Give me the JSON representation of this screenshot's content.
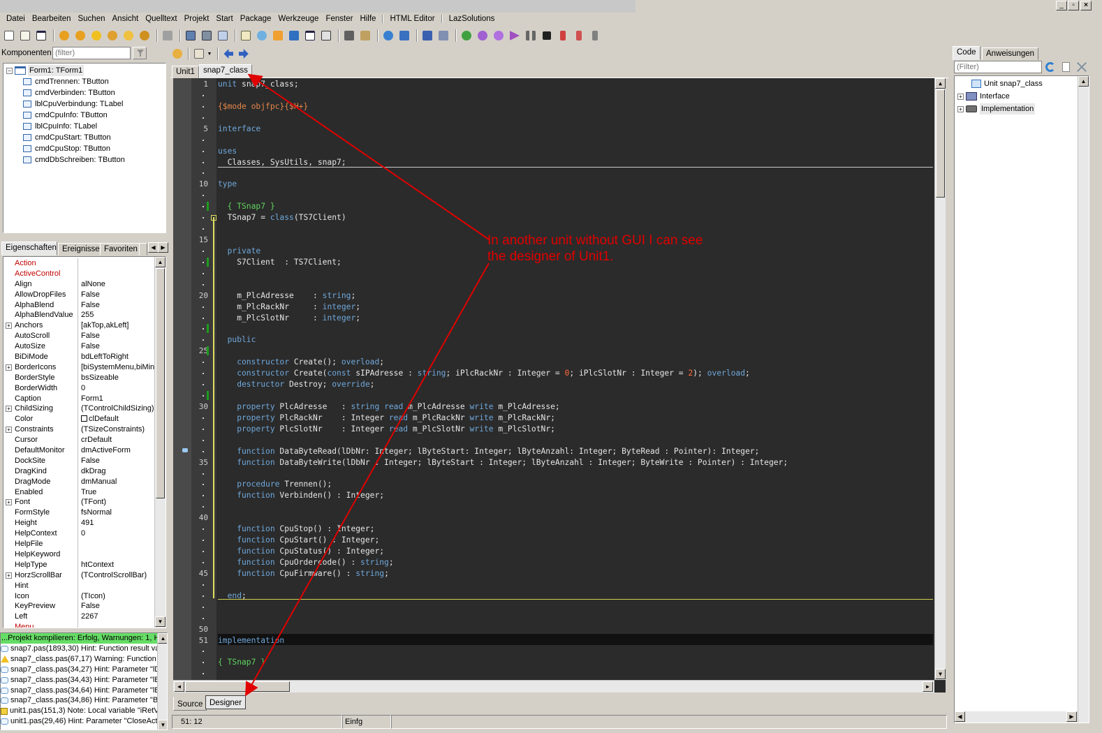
{
  "menu": [
    "Datei",
    "Bearbeiten",
    "Suchen",
    "Ansicht",
    "Quelltext",
    "Projekt",
    "Start",
    "Package",
    "Werkzeuge",
    "Fenster",
    "Hilfe",
    "HTML Editor",
    "LazSolutions"
  ],
  "window_buttons": [
    "_",
    "▫",
    "×"
  ],
  "components": {
    "label": "Komponenten",
    "filter_placeholder": "(filter)",
    "root": "Form1: TForm1",
    "items": [
      "cmdTrennen: TButton",
      "cmdVerbinden: TButton",
      "lblCpuVerbindung: TLabel",
      "cmdCpuInfo: TButton",
      "lblCpuInfo: TLabel",
      "cmdCpuStart: TButton",
      "cmdCpuStop: TButton",
      "cmdDbSchreiben: TButton"
    ]
  },
  "inspector_tabs": [
    "Eigenschaften",
    "Ereignisse",
    "Favoriten"
  ],
  "properties": [
    {
      "n": "Action",
      "v": "",
      "red": true
    },
    {
      "n": "ActiveControl",
      "v": "",
      "red": true
    },
    {
      "n": "Align",
      "v": "alNone"
    },
    {
      "n": "AllowDropFiles",
      "v": "False"
    },
    {
      "n": "AlphaBlend",
      "v": "False"
    },
    {
      "n": "AlphaBlendValue",
      "v": "255"
    },
    {
      "n": "Anchors",
      "v": "[akTop,akLeft]",
      "plus": true
    },
    {
      "n": "AutoScroll",
      "v": "False"
    },
    {
      "n": "AutoSize",
      "v": "False"
    },
    {
      "n": "BiDiMode",
      "v": "bdLeftToRight"
    },
    {
      "n": "BorderIcons",
      "v": "[biSystemMenu,biMini",
      "plus": true
    },
    {
      "n": "BorderStyle",
      "v": "bsSizeable"
    },
    {
      "n": "BorderWidth",
      "v": "0"
    },
    {
      "n": "Caption",
      "v": "Form1"
    },
    {
      "n": "ChildSizing",
      "v": "(TControlChildSizing)",
      "plus": true
    },
    {
      "n": "Color",
      "v": "clDefault",
      "swatch": true
    },
    {
      "n": "Constraints",
      "v": "(TSizeConstraints)",
      "plus": true
    },
    {
      "n": "Cursor",
      "v": "crDefault"
    },
    {
      "n": "DefaultMonitor",
      "v": "dmActiveForm"
    },
    {
      "n": "DockSite",
      "v": "False"
    },
    {
      "n": "DragKind",
      "v": "dkDrag"
    },
    {
      "n": "DragMode",
      "v": "dmManual"
    },
    {
      "n": "Enabled",
      "v": "True"
    },
    {
      "n": "Font",
      "v": "(TFont)",
      "plus": true
    },
    {
      "n": "FormStyle",
      "v": "fsNormal"
    },
    {
      "n": "Height",
      "v": "491"
    },
    {
      "n": "HelpContext",
      "v": "0"
    },
    {
      "n": "HelpFile",
      "v": ""
    },
    {
      "n": "HelpKeyword",
      "v": ""
    },
    {
      "n": "HelpType",
      "v": "htContext"
    },
    {
      "n": "HorzScrollBar",
      "v": "(TControlScrollBar)",
      "plus": true
    },
    {
      "n": "Hint",
      "v": ""
    },
    {
      "n": "Icon",
      "v": "(TIcon)"
    },
    {
      "n": "KeyPreview",
      "v": "False"
    },
    {
      "n": "Left",
      "v": "2267"
    },
    {
      "n": "Menu",
      "v": "",
      "red": true
    }
  ],
  "messages": {
    "header": "...Projekt kompilieren: Erfolg, Warnungen: 1, H",
    "items": [
      {
        "t": "snap7.pas(1893,30) Hint: Function result va",
        "k": "hint"
      },
      {
        "t": "snap7_class.pas(67,17) Warning: Function",
        "k": "warn"
      },
      {
        "t": "snap7_class.pas(34,27) Hint: Parameter \"lD",
        "k": "hint"
      },
      {
        "t": "snap7_class.pas(34,43) Hint: Parameter \"lB",
        "k": "hint"
      },
      {
        "t": "snap7_class.pas(34,64) Hint: Parameter \"lB",
        "k": "hint"
      },
      {
        "t": "snap7_class.pas(34,86) Hint: Parameter \"By",
        "k": "hint"
      },
      {
        "t": "unit1.pas(151,3) Note: Local variable \"iRetV",
        "k": "note"
      },
      {
        "t": "unit1.pas(29,46) Hint: Parameter \"CloseAct",
        "k": "hint"
      }
    ]
  },
  "editor_tabs": [
    "Unit1",
    "snap7_class"
  ],
  "bottom_tabs": [
    "Source",
    "Designer"
  ],
  "status": {
    "pos": "51: 12",
    "mode": "Einfg"
  },
  "line_numbers": [
    {
      "line": 1,
      "text": "1"
    },
    {
      "line": 5,
      "text": "5"
    },
    {
      "line": 10,
      "text": "10"
    },
    {
      "line": 15,
      "text": "15"
    },
    {
      "line": 20,
      "text": "20"
    },
    {
      "line": 25,
      "text": "25"
    },
    {
      "line": 30,
      "text": "30"
    },
    {
      "line": 35,
      "text": "35"
    },
    {
      "line": 40,
      "text": "40"
    },
    {
      "line": 45,
      "text": "45"
    },
    {
      "line": 50,
      "text": "50"
    },
    {
      "line": 51,
      "text": "51"
    }
  ],
  "code": [
    {
      "l": 1,
      "s": [
        [
          "kw",
          "unit "
        ],
        [
          "",
          "snap7_class;"
        ]
      ]
    },
    {
      "l": 3,
      "s": [
        [
          "dir",
          "{$mode objfpc}{$H+}"
        ]
      ]
    },
    {
      "l": 5,
      "s": [
        [
          "kw",
          "interface"
        ]
      ]
    },
    {
      "l": 7,
      "s": [
        [
          "kw",
          "uses"
        ]
      ]
    },
    {
      "l": 8,
      "s": [
        [
          "",
          "  Classes, SysUtils, snap7;"
        ]
      ]
    },
    {
      "l": 10,
      "s": [
        [
          "kw",
          "type"
        ]
      ]
    },
    {
      "l": 12,
      "s": [
        [
          "cm",
          "  { TSnap7 }"
        ]
      ]
    },
    {
      "l": 13,
      "s": [
        [
          "",
          "  TSnap7 = "
        ],
        [
          "kw",
          "class"
        ],
        [
          "",
          "(TS7Client)"
        ]
      ]
    },
    {
      "l": 16,
      "s": [
        [
          "kw",
          "  private"
        ]
      ]
    },
    {
      "l": 17,
      "s": [
        [
          "",
          "    S7Client  : TS7Client;"
        ]
      ]
    },
    {
      "l": 20,
      "s": [
        [
          "",
          "    m_PlcAdresse    : "
        ],
        [
          "kw",
          "string"
        ],
        [
          "",
          ";"
        ]
      ]
    },
    {
      "l": 21,
      "s": [
        [
          "",
          "    m_PlcRackNr     : "
        ],
        [
          "kw",
          "integer"
        ],
        [
          "",
          ";"
        ]
      ]
    },
    {
      "l": 22,
      "s": [
        [
          "",
          "    m_PlcSlotNr     : "
        ],
        [
          "kw",
          "integer"
        ],
        [
          "",
          ";"
        ]
      ]
    },
    {
      "l": 24,
      "s": [
        [
          "kw",
          "  public"
        ]
      ]
    },
    {
      "l": 26,
      "s": [
        [
          "kw",
          "    constructor "
        ],
        [
          "",
          "Create(); "
        ],
        [
          "kw",
          "overload"
        ],
        [
          "",
          ";"
        ]
      ]
    },
    {
      "l": 27,
      "s": [
        [
          "kw",
          "    constructor "
        ],
        [
          "",
          "Create("
        ],
        [
          "kw",
          "const "
        ],
        [
          "",
          "sIPAdresse : "
        ],
        [
          "kw",
          "string"
        ],
        [
          "",
          "; iPlcRackNr : Integer = "
        ],
        [
          "num",
          "0"
        ],
        [
          "",
          "; iPlcSlotNr : Integer = "
        ],
        [
          "num",
          "2"
        ],
        [
          "",
          "); "
        ],
        [
          "kw",
          "overload"
        ],
        [
          "",
          ";"
        ]
      ]
    },
    {
      "l": 28,
      "s": [
        [
          "kw",
          "    destructor "
        ],
        [
          "",
          "Destroy; "
        ],
        [
          "kw",
          "override"
        ],
        [
          "",
          ";"
        ]
      ]
    },
    {
      "l": 30,
      "s": [
        [
          "kw",
          "    property "
        ],
        [
          "",
          "PlcAdresse   : "
        ],
        [
          "kw",
          "string "
        ],
        [
          "kw",
          "read "
        ],
        [
          "",
          "m_PlcAdresse "
        ],
        [
          "kw",
          "write "
        ],
        [
          "",
          "m_PlcAdresse;"
        ]
      ]
    },
    {
      "l": 31,
      "s": [
        [
          "kw",
          "    property "
        ],
        [
          "",
          "PlcRackNr    : Integer "
        ],
        [
          "kw",
          "read "
        ],
        [
          "",
          "m_PlcRackNr "
        ],
        [
          "kw",
          "write "
        ],
        [
          "",
          "m_PlcRackNr;"
        ]
      ]
    },
    {
      "l": 32,
      "s": [
        [
          "kw",
          "    property "
        ],
        [
          "",
          "PlcSlotNr    : Integer "
        ],
        [
          "kw",
          "read "
        ],
        [
          "",
          "m_PlcSlotNr "
        ],
        [
          "kw",
          "write "
        ],
        [
          "",
          "m_PlcSlotNr;"
        ]
      ]
    },
    {
      "l": 34,
      "s": [
        [
          "kw",
          "    function "
        ],
        [
          "",
          "DataByteRead(lDbNr: Integer; lByteStart: Integer; lByteAnzahl: Integer; ByteRead : Pointer): Integer;"
        ]
      ]
    },
    {
      "l": 35,
      "s": [
        [
          "kw",
          "    function "
        ],
        [
          "",
          "DataByteWrite(lDbNr : Integer; lByteStart : Integer; lByteAnzahl : Integer; ByteWrite : Pointer) : Integer;"
        ]
      ]
    },
    {
      "l": 37,
      "s": [
        [
          "kw",
          "    procedure "
        ],
        [
          "",
          "Trennen();"
        ]
      ]
    },
    {
      "l": 38,
      "s": [
        [
          "kw",
          "    function "
        ],
        [
          "",
          "Verbinden() : Integer;"
        ]
      ]
    },
    {
      "l": 41,
      "s": [
        [
          "kw",
          "    function "
        ],
        [
          "",
          "CpuStop() : Integer;"
        ]
      ]
    },
    {
      "l": 42,
      "s": [
        [
          "kw",
          "    function "
        ],
        [
          "",
          "CpuStart() : Integer;"
        ]
      ]
    },
    {
      "l": 43,
      "s": [
        [
          "kw",
          "    function "
        ],
        [
          "",
          "CpuStatus() : Integer;"
        ]
      ]
    },
    {
      "l": 44,
      "s": [
        [
          "kw",
          "    function "
        ],
        [
          "",
          "CpuOrdercode() : "
        ],
        [
          "kw",
          "string"
        ],
        [
          "",
          ";"
        ]
      ]
    },
    {
      "l": 45,
      "s": [
        [
          "kw",
          "    function "
        ],
        [
          "",
          "CpuFirmware() : "
        ],
        [
          "kw",
          "string"
        ],
        [
          "",
          ";"
        ]
      ]
    },
    {
      "l": 47,
      "s": [
        [
          "kw",
          "  end"
        ],
        [
          "",
          ";"
        ]
      ]
    },
    {
      "l": 51,
      "s": [
        [
          "kw",
          "implementation"
        ]
      ]
    },
    {
      "l": 53,
      "s": [
        [
          "cm",
          "{ TSnap7 }"
        ]
      ]
    }
  ],
  "code_explorer": {
    "tabs": [
      "Code",
      "Anweisungen"
    ],
    "filter_placeholder": "(Filter)",
    "items": [
      "Unit snap7_class",
      "Interface",
      "Implementation"
    ]
  },
  "annotation": {
    "line1": "In another unit without GUI I can see",
    "line2": "the designer of Unit1.",
    "color": "#e00000"
  }
}
